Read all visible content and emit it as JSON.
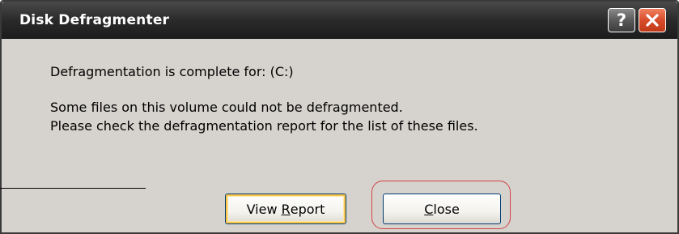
{
  "window": {
    "title": "Disk Defragmenter",
    "help_icon": "help-icon",
    "close_icon": "close-icon"
  },
  "message": {
    "line1": "Defragmentation is complete for: (C:)",
    "line2": "Some files on this volume could not be defragmented.",
    "line3": "Please check the defragmentation report for the list of these files."
  },
  "buttons": {
    "view_report_prefix": "View ",
    "view_report_underlined": "R",
    "view_report_suffix": "eport",
    "close_underlined": "C",
    "close_suffix": "lose"
  },
  "colors": {
    "titlebar": "#2a2a2a",
    "close_button": "#d84c2a",
    "highlight_ring": "#d24444"
  }
}
